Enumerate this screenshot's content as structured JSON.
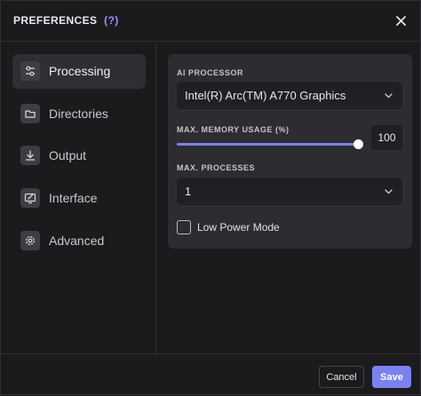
{
  "header": {
    "title": "PREFERENCES",
    "help_open": "(",
    "help_q": "?",
    "help_close": ")"
  },
  "sidebar": {
    "items": [
      {
        "label": "Processing",
        "icon": "sliders-icon",
        "active": true
      },
      {
        "label": "Directories",
        "icon": "folder-icon",
        "active": false
      },
      {
        "label": "Output",
        "icon": "download-icon",
        "active": false
      },
      {
        "label": "Interface",
        "icon": "monitor-edit-icon",
        "active": false
      },
      {
        "label": "Advanced",
        "icon": "gear-icon",
        "active": false
      }
    ]
  },
  "processing": {
    "ai_processor_label": "AI PROCESSOR",
    "ai_processor_value": "Intel(R) Arc(TM) A770 Graphics",
    "memory_label": "MAX. MEMORY USAGE (%)",
    "memory_value": "100",
    "memory_fraction": 1.0,
    "processes_label": "MAX. PROCESSES",
    "processes_value": "1",
    "low_power_label": "Low Power Mode",
    "low_power_checked": false
  },
  "footer": {
    "cancel_label": "Cancel",
    "save_label": "Save"
  },
  "colors": {
    "accent": "#7b82f0",
    "background": "#1b1b1e",
    "panel": "#2c2c31"
  }
}
